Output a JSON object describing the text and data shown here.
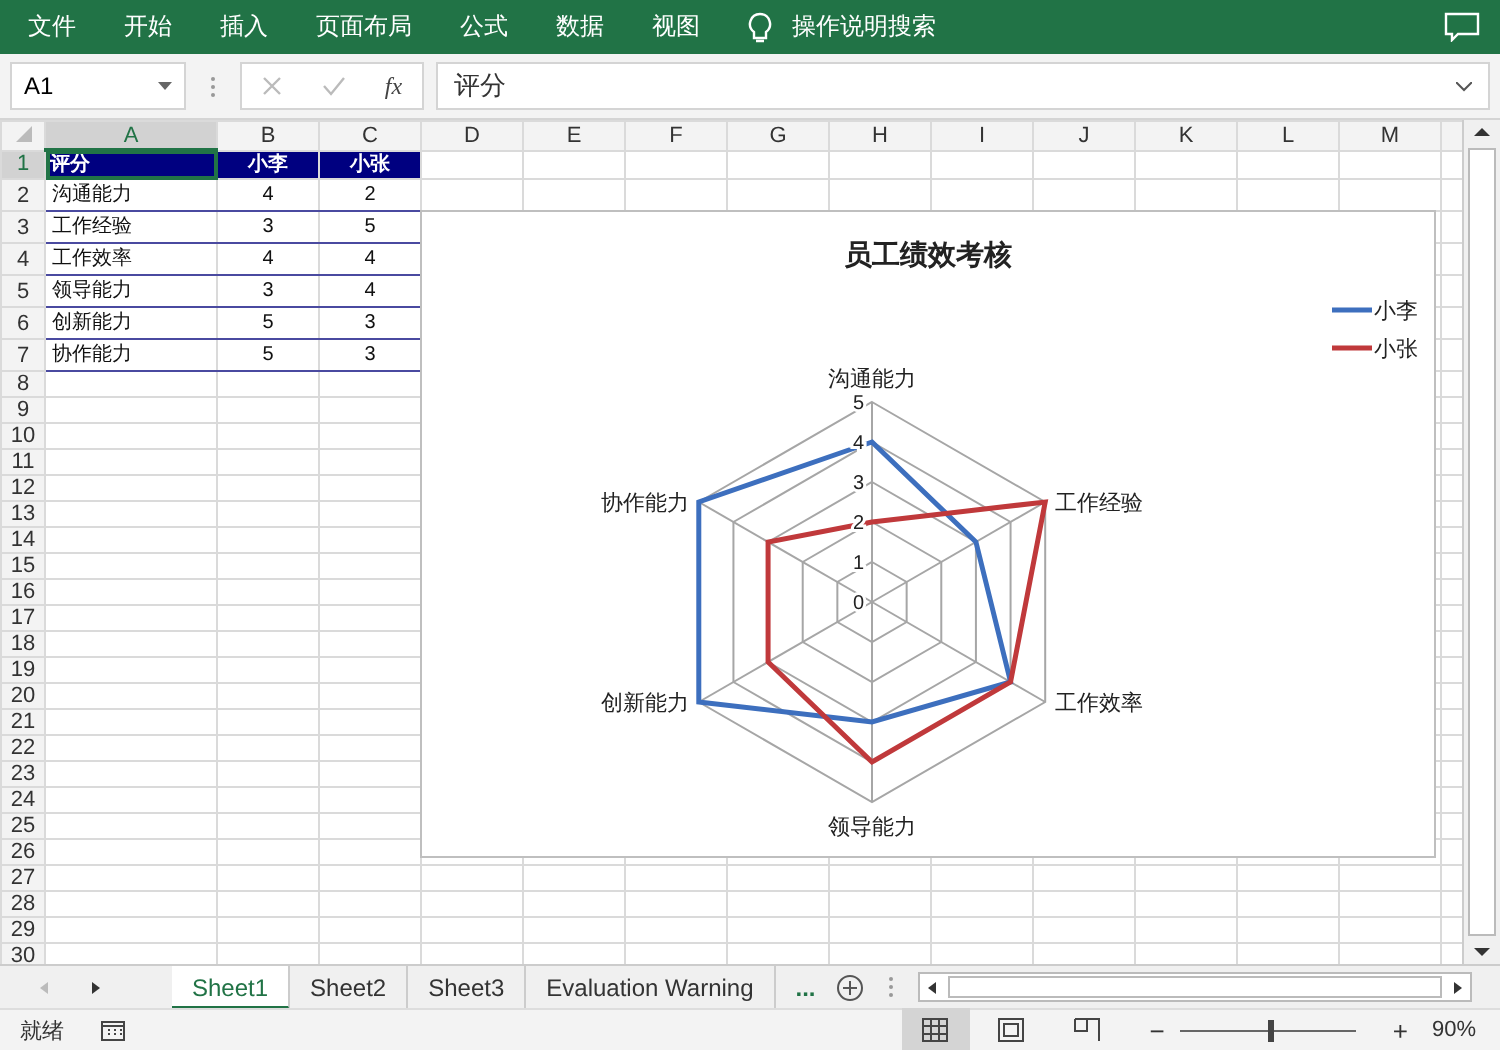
{
  "ribbon_tabs": [
    "文件",
    "开始",
    "插入",
    "页面布局",
    "公式",
    "数据",
    "视图"
  ],
  "tell_me": "操作说明搜索",
  "formula_bar": {
    "name_box": "A1",
    "fx": "fx",
    "formula": "评分"
  },
  "columns": [
    {
      "label": "A",
      "selected": true
    },
    {
      "label": "B",
      "selected": false
    },
    {
      "label": "C",
      "selected": false
    },
    {
      "label": "D",
      "selected": false
    },
    {
      "label": "E",
      "selected": false
    },
    {
      "label": "F",
      "selected": false
    },
    {
      "label": "G",
      "selected": false
    },
    {
      "label": "H",
      "selected": false
    },
    {
      "label": "I",
      "selected": false
    },
    {
      "label": "J",
      "selected": false
    },
    {
      "label": "K",
      "selected": false
    },
    {
      "label": "L",
      "selected": false
    },
    {
      "label": "M",
      "selected": false
    }
  ],
  "row_numbers": [
    "1",
    "2",
    "3",
    "4",
    "5",
    "6",
    "7",
    "8",
    "9",
    "10",
    "11",
    "12",
    "13",
    "14",
    "15",
    "16",
    "17",
    "18",
    "19",
    "20",
    "21",
    "22",
    "23",
    "24",
    "25",
    "26",
    "27",
    "28",
    "29",
    "30"
  ],
  "table": {
    "header": [
      "评分",
      "小李",
      "小张"
    ],
    "rows": [
      [
        "沟通能力",
        "4",
        "2"
      ],
      [
        "工作经验",
        "3",
        "5"
      ],
      [
        "工作效率",
        "4",
        "4"
      ],
      [
        "领导能力",
        "3",
        "4"
      ],
      [
        "创新能力",
        "5",
        "3"
      ],
      [
        "协作能力",
        "5",
        "3"
      ]
    ]
  },
  "chart_data": {
    "type": "radar",
    "title": "员工绩效考核",
    "categories": [
      "沟通能力",
      "工作经验",
      "工作效率",
      "领导能力",
      "创新能力",
      "协作能力"
    ],
    "yticks": [
      0,
      1,
      2,
      3,
      4,
      5
    ],
    "legend": true,
    "ylim": [
      0,
      5
    ],
    "series": [
      {
        "name": "小李",
        "color": "#3d6fbe",
        "values": [
          4,
          3,
          4,
          3,
          5,
          5
        ]
      },
      {
        "name": "小张",
        "color": "#c0393b",
        "values": [
          2,
          5,
          4,
          4,
          3,
          3
        ]
      }
    ]
  },
  "sheet_tabs": [
    {
      "label": "Sheet1",
      "selected": true
    },
    {
      "label": "Sheet2",
      "selected": false
    },
    {
      "label": "Sheet3",
      "selected": false
    },
    {
      "label": "Evaluation Warning",
      "selected": false
    }
  ],
  "more_sheets": "...",
  "status": "就绪",
  "zoom": {
    "minus": "−",
    "plus": "+",
    "level": 0.5,
    "reading": "90%"
  }
}
